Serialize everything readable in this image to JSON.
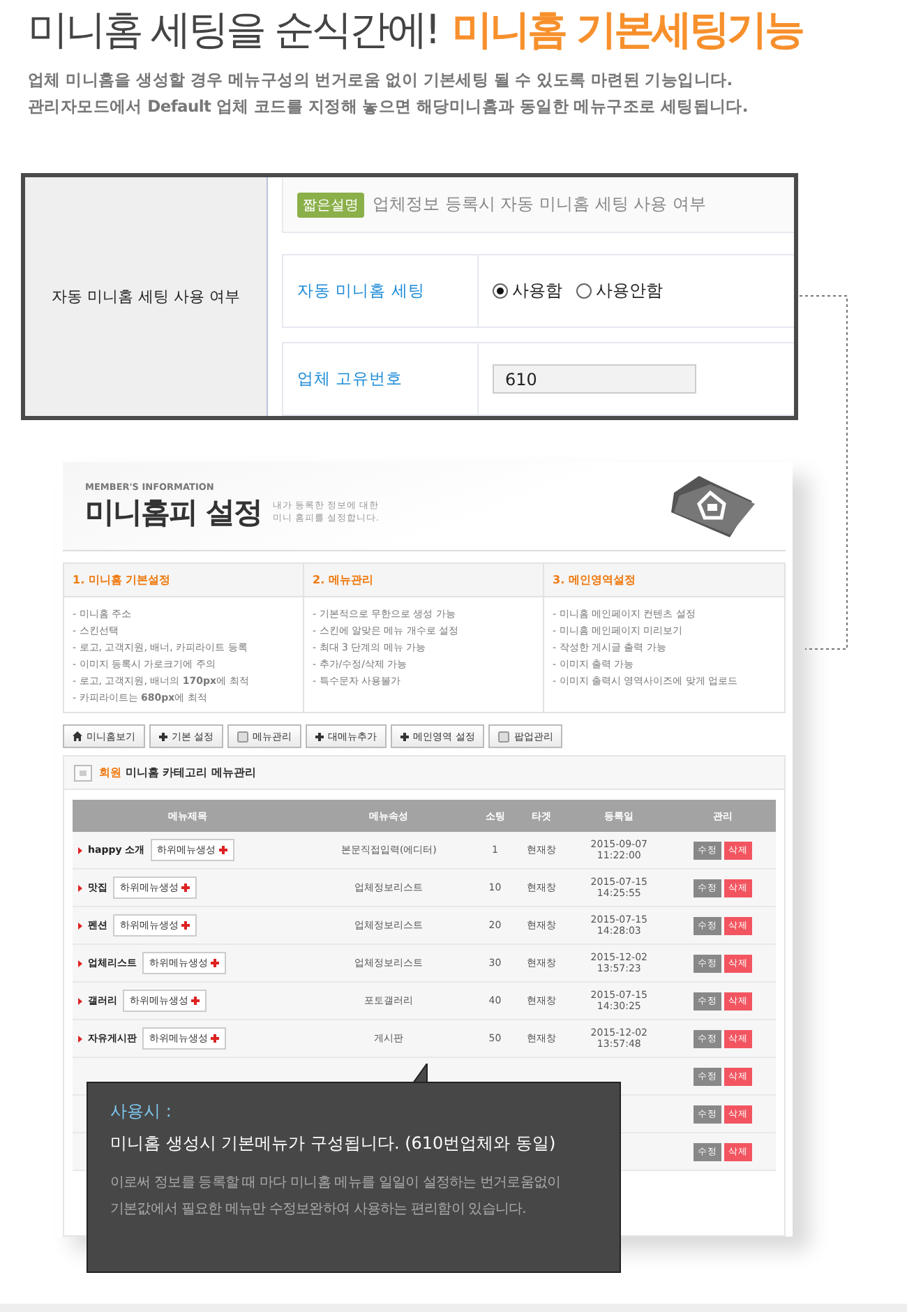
{
  "headline": {
    "text": "미니홈 세팅을 순식간에!",
    "highlight": "미니홈 기본세팅기능"
  },
  "intro": [
    "업체 미니홈을 생성할 경우 메뉴구성의 번거로움 없이 기본세팅 될 수 있도록 마련된 기능입니다.",
    "관리자모드에서 Default 업체 코드를 지정해 놓으면 해당미니홈과 동일한 메뉴구조로 세팅됩니다."
  ],
  "settings_panel": {
    "label": "자동 미니홈 세팅 사용 여부",
    "badge": "짧은설명",
    "description": "업체정보 등록시 자동 미니홈 세팅 사용 여부",
    "fields": [
      {
        "kind": "radio",
        "label": "자동 미니홈 세팅",
        "options": [
          {
            "label": "사용함",
            "selected": true
          },
          {
            "label": "사용안함",
            "selected": false
          }
        ]
      },
      {
        "kind": "text",
        "label": "업체 고유번호",
        "value": "610"
      }
    ]
  },
  "mini_home_screen": {
    "eyebrow": "MEMBER'S INFORMATION",
    "title": "미니홈피 설정",
    "subtitle": [
      "내가 등록한 정보에 대한",
      "미니 홈피를 설정합니다."
    ],
    "sections": [
      {
        "title": "1. 미니홈 기본설정",
        "items": [
          "- 미니홈 주소",
          "- 스킨선택",
          "- 로고, 고객지원, 배너, 카피라이트 등록",
          "- 이미지 등록시 가로크기에 주의",
          "- 로고, 고객지원, 배너의 **170px**에 최적",
          "- 카피라이트는 **680px**에 최적"
        ]
      },
      {
        "title": "2. 메뉴관리",
        "items": [
          "- 기본적으로 무한으로 생성 가능",
          "- 스킨에 알맞은 메뉴 개수로 설정",
          "- 최대 3 단계의 메뉴 가능",
          "- 추가/수정/삭제 가능",
          "- 특수문자 사용불가"
        ]
      },
      {
        "title": "3. 메인영역설정",
        "items": [
          "- 미니홈 메인페이지 컨텐츠 설정",
          "- 미니홈 메인페이지 미리보기",
          "- 작성한 게시글 출력 가능",
          "- 이미지 출력 가능",
          "- 이미지 출력시 영역사이즈에 맞게 업로드"
        ]
      }
    ],
    "toolbar": [
      {
        "label": "미니홈보기",
        "kind": "home"
      },
      {
        "label": "기본 설정",
        "kind": "add"
      },
      {
        "label": "메뉴관리",
        "kind": "page"
      },
      {
        "label": "대메뉴추가",
        "kind": "add"
      },
      {
        "label": "메인영역 설정",
        "kind": "add"
      },
      {
        "label": "팝업관리",
        "kind": "page"
      }
    ],
    "panel": {
      "highlight": "회원",
      "title": "미니홈 카테고리 메뉴관리"
    },
    "table": {
      "columns": [
        "메뉴제목",
        "메뉴속성",
        "소팅",
        "타겟",
        "등록일",
        "관리"
      ],
      "rows": [
        {
          "title": "happy 소개",
          "submenu_button": "하위메뉴생성",
          "type": "본문직접입력(에디터)",
          "sort": "1",
          "target": "현재창",
          "date": "2015-09-07",
          "time": "11:22:00",
          "edit": "수정",
          "delete": "삭제"
        },
        {
          "title": "맛집",
          "submenu_button": "하위메뉴생성",
          "type": "업체정보리스트",
          "sort": "10",
          "target": "현재창",
          "date": "2015-07-15",
          "time": "14:25:55",
          "edit": "수정",
          "delete": "삭제"
        },
        {
          "title": "펜션",
          "submenu_button": "하위메뉴생성",
          "type": "업체정보리스트",
          "sort": "20",
          "target": "현재창",
          "date": "2015-07-15",
          "time": "14:28:03",
          "edit": "수정",
          "delete": "삭제"
        },
        {
          "title": "업체리스트",
          "submenu_button": "하위메뉴생성",
          "type": "업체정보리스트",
          "sort": "30",
          "target": "현재창",
          "date": "2015-12-02",
          "time": "13:57:23",
          "edit": "수정",
          "delete": "삭제"
        },
        {
          "title": "갤러리",
          "submenu_button": "하위메뉴생성",
          "type": "포토갤러리",
          "sort": "40",
          "target": "현재창",
          "date": "2015-07-15",
          "time": "14:30:25",
          "edit": "수정",
          "delete": "삭제"
        },
        {
          "title": "자유게시판",
          "submenu_button": "하위메뉴생성",
          "type": "게시판",
          "sort": "50",
          "target": "현재창",
          "date": "2015-12-02",
          "time": "13:57:48",
          "edit": "수정",
          "delete": "삭제"
        },
        {
          "edit": "수정",
          "delete": "삭제"
        },
        {
          "edit": "수정",
          "delete": "삭제"
        },
        {
          "edit": "수정",
          "delete": "삭제"
        }
      ]
    }
  },
  "tooltip": {
    "heading": "사용시 :",
    "lead": "미니홈 생성시 기본메뉴가 구성됩니다. (610번업체와 동일)",
    "body": [
      "이로써 정보를 등록할 때 마다 미니홈 메뉴를 일일이 설정하는 번거로움없이",
      "기본값에서 필요한 메뉴만 수정보완하여 사용하는 편리함이 있습니다."
    ]
  }
}
